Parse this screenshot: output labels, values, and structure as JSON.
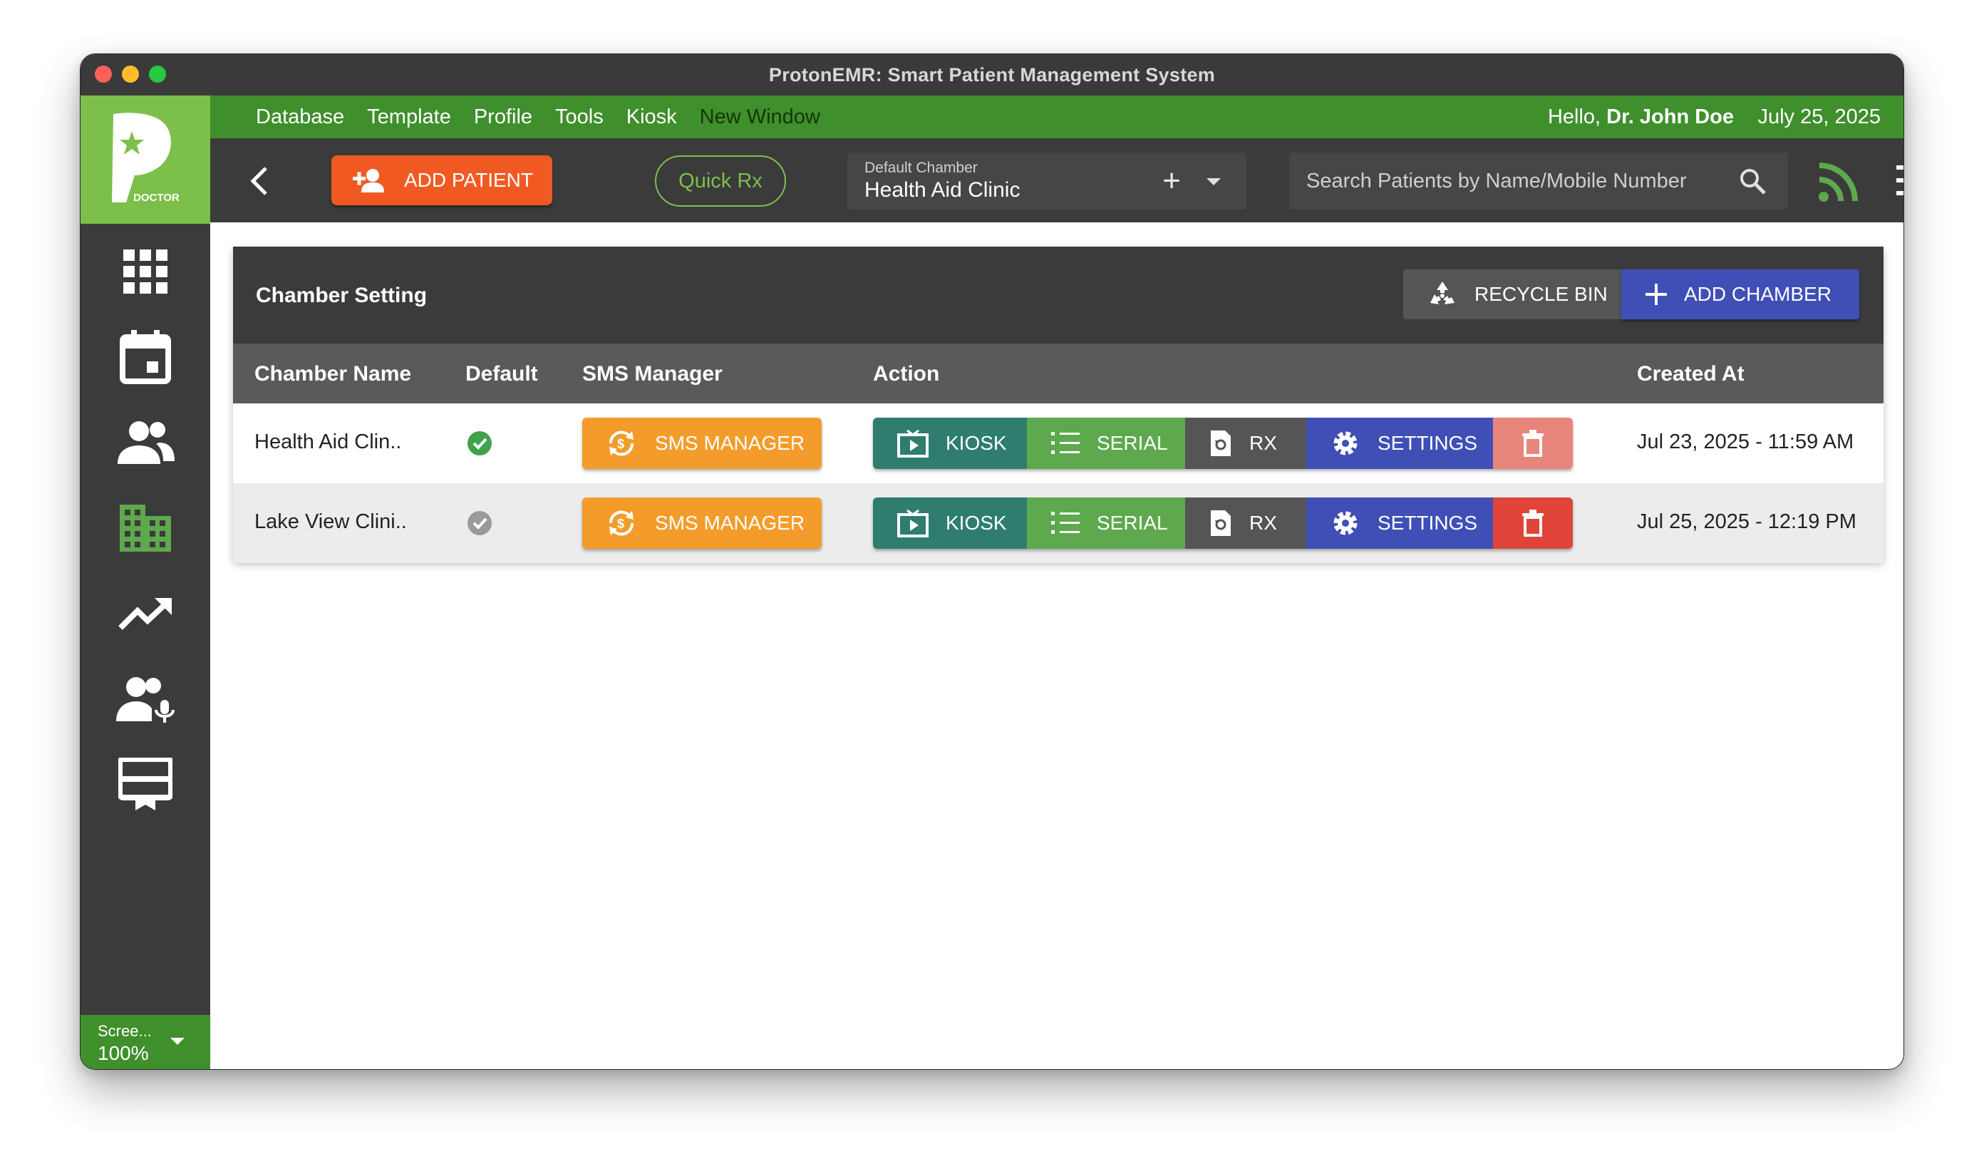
{
  "window": {
    "title": "ProtonEMR: Smart Patient Management System"
  },
  "sidebar": {
    "logo_text": "DOCTOR",
    "items": [
      {
        "name": "dashboard-grid"
      },
      {
        "name": "calendar"
      },
      {
        "name": "patients"
      },
      {
        "name": "chamber"
      },
      {
        "name": "analytics"
      },
      {
        "name": "assistants"
      },
      {
        "name": "kiosk-display"
      }
    ],
    "zoom": {
      "label": "Scree...",
      "value": "100%"
    }
  },
  "menubar": {
    "items": [
      "Database",
      "Template",
      "Profile",
      "Tools",
      "Kiosk",
      "New Window"
    ],
    "greeting_prefix": "Hello, ",
    "user_name": "Dr. John Doe",
    "date": "July 25, 2025"
  },
  "toolbar": {
    "add_patient_label": "ADD PATIENT",
    "quick_rx_label": "Quick Rx",
    "chamber_select": {
      "label": "Default Chamber",
      "value": "Health Aid Clinic"
    },
    "search_placeholder": "Search Patients by Name/Mobile Number"
  },
  "card": {
    "title": "Chamber Setting",
    "recycle_bin_label": "RECYCLE BIN",
    "add_chamber_label": "ADD CHAMBER",
    "columns": [
      "Chamber Name",
      "Default",
      "SMS Manager",
      "Action",
      "Created At"
    ],
    "rows": [
      {
        "name": "Health Aid Clin..",
        "default": true,
        "sms_label": "SMS MANAGER",
        "kiosk": "KIOSK",
        "serial": "SERIAL",
        "rx": "RX",
        "settings": "SETTINGS",
        "created_at": "Jul 23, 2025 - 11:59 AM"
      },
      {
        "name": "Lake View Clini..",
        "default": false,
        "sms_label": "SMS MANAGER",
        "kiosk": "KIOSK",
        "serial": "SERIAL",
        "rx": "RX",
        "settings": "SETTINGS",
        "created_at": "Jul 25, 2025 - 12:19 PM"
      }
    ]
  },
  "colors": {
    "brand_green": "#3f8f2c",
    "logo_green": "#7cbf4b",
    "add_patient_orange": "#f05a22",
    "sms_orange": "#f39c2b",
    "kiosk_teal": "#2e7d6e",
    "serial_green": "#5ea84e",
    "settings_indigo": "#3f4fb5",
    "delete_red": "#e04438"
  }
}
